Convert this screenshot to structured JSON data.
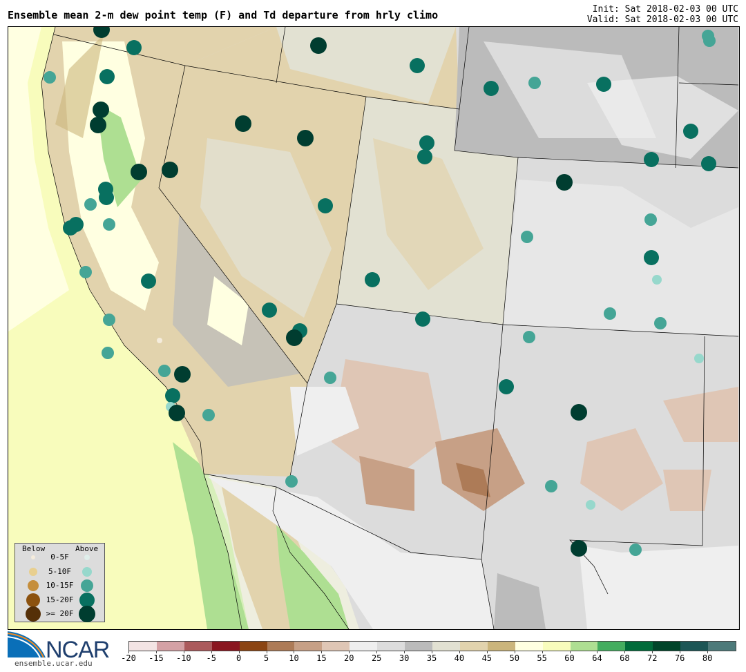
{
  "header": {
    "title": "Ensemble mean 2-m dew point temp (F) and Td departure from hrly climo",
    "init": "Init: Sat 2018-02-03 00 UTC",
    "valid": "Valid: Sat 2018-02-03 00 UTC"
  },
  "legend": {
    "below_label": "Below",
    "above_label": "Above",
    "rows": [
      {
        "label": "0-5F",
        "below_color": "#f5ecdc",
        "above_color": "#dfeeea"
      },
      {
        "label": "5-10F",
        "below_color": "#e8cf8f",
        "above_color": "#97d8cc"
      },
      {
        "label": "10-15F",
        "below_color": "#c58e3c",
        "above_color": "#45a596"
      },
      {
        "label": "15-20F",
        "below_color": "#8c520f",
        "above_color": "#087060"
      },
      {
        "label": ">= 20F",
        "below_color": "#553008",
        "above_color": "#003d30"
      }
    ]
  },
  "colorbar": {
    "colors": [
      "#f3e4e4",
      "#d4a1a5",
      "#ab5a5c",
      "#8a1620",
      "#8b4513",
      "#ad7b57",
      "#c7a086",
      "#dfc6b5",
      "#efefef",
      "#dcdcdc",
      "#bbbbbb",
      "#e2e1d2",
      "#e2d3ad",
      "#cbb57c",
      "#ffffe1",
      "#f8fcbc",
      "#aedf92",
      "#44ad5f",
      "#006b3a",
      "#00452a",
      "#1c5656",
      "#4d7a7a"
    ],
    "ticks": [
      "-20",
      "-15",
      "-10",
      "-5",
      "0",
      "5",
      "10",
      "15",
      "20",
      "25",
      "30",
      "35",
      "40",
      "45",
      "50",
      "55",
      "60",
      "64",
      "68",
      "72",
      "76",
      "80"
    ]
  },
  "logo": {
    "text": "NCAR",
    "url": "ensemble.ucar.edu"
  },
  "stations": [
    "above >= 20F",
    "above 15-20F",
    "above >= 20F",
    "above 10-15F",
    "above 15-20F",
    "above 15-20F",
    "above 15-20F",
    "above 10-15F",
    "above 15-20F",
    "above 10-15F",
    "above 10-15F",
    "above >= 20F",
    "above >= 20F",
    "above >= 20F",
    "above >= 20F",
    "above 15-20F",
    "above 15-20F",
    "above 15-20F",
    "above 15-20F",
    "above 15-20F",
    "above >= 20F",
    "above >= 20F",
    "above >= 20F",
    "above 15-20F",
    "above 15-20F",
    "above 10-15F",
    "above 15-20F",
    "above 15-20F",
    "above 15-20F",
    "above 10-15F",
    "above 10-15F",
    "above 10-15F",
    "above 15-20F",
    "above 10-15F",
    "above 15-20F",
    "above 15-20F",
    "above 5-10F",
    "above 15-20F",
    "above 10-15F",
    "above 10-15F",
    "above 10-15F",
    "above 15-20F",
    "above 15-20F",
    "above >= 20F",
    "above 10-15F",
    "below 0-5F",
    "above 10-15F",
    "above 5-10F",
    "above 10-15F",
    "above >= 20F",
    "above 10-15F",
    "above 15-20F",
    "above 15-20F",
    "above 5-10F",
    "above >= 20F",
    "above 10-15F",
    "above >= 20F",
    "above 10-15F",
    "above 10-15F",
    "above 5-10F",
    "above >= 20F",
    "above 10-15F"
  ]
}
